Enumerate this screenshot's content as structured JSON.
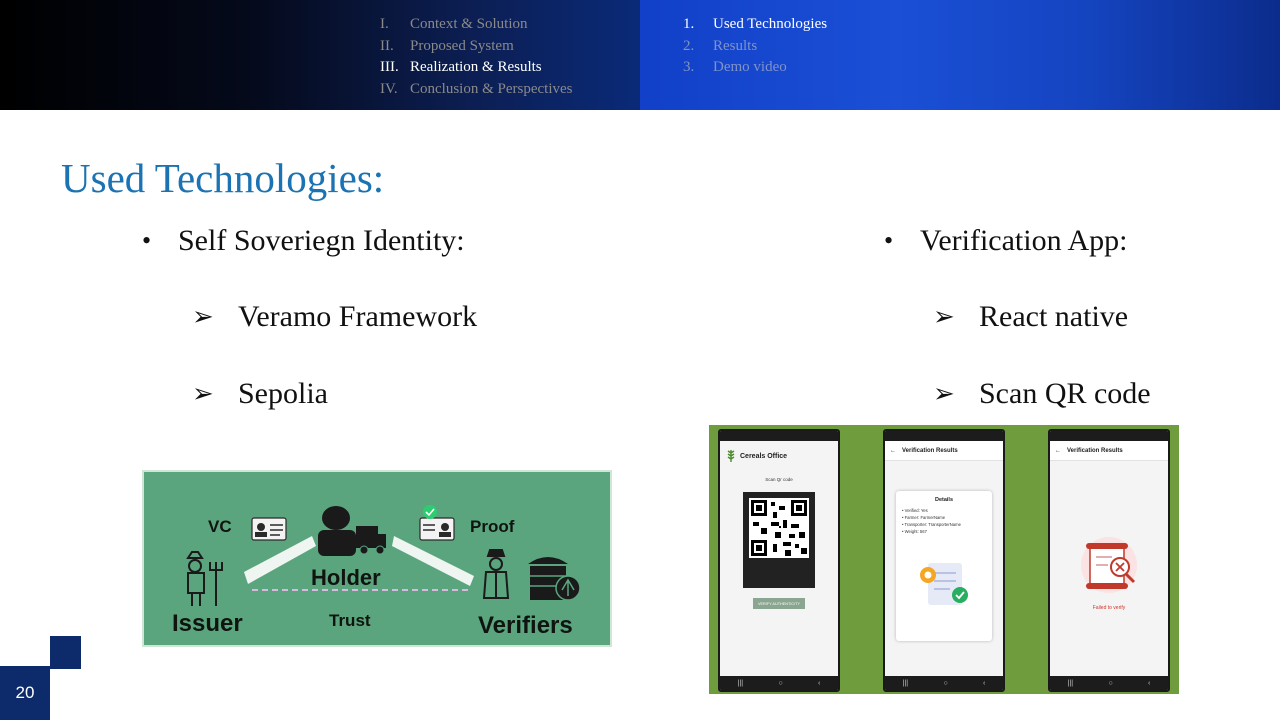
{
  "outline": [
    {
      "num": "I.",
      "label": "Context & Solution",
      "active": false
    },
    {
      "num": "II.",
      "label": "Proposed System",
      "active": false
    },
    {
      "num": "III.",
      "label": "Realization  & Results",
      "active": true
    },
    {
      "num": "IV.",
      "label": "Conclusion & Perspectives",
      "active": false
    }
  ],
  "subnav": [
    {
      "num": "1.",
      "label": "Used Technologies",
      "active": true
    },
    {
      "num": "2.",
      "label": "Results",
      "active": false
    },
    {
      "num": "3.",
      "label": "Demo video",
      "active": false
    }
  ],
  "title": "Used Technologies:",
  "left": {
    "bullet": "Self Soveriegn Identity:",
    "items": [
      "Veramo Framework",
      "Sepolia"
    ]
  },
  "right": {
    "bullet": "Verification App:",
    "items": [
      "React native",
      "Scan QR code"
    ]
  },
  "ssi_diagram": {
    "vc": "VC",
    "proof": "Proof",
    "holder": "Holder",
    "issuer": "Issuer",
    "trust": "Trust",
    "verifiers": "Verifiers"
  },
  "phones": {
    "phone1": {
      "app_title": "Cereals Office",
      "scan_label": "Scan Qr code",
      "button": "VERIFY AUTHENTICITY"
    },
    "phone2": {
      "title": "Verification Results",
      "details_heading": "Details",
      "details": [
        "• Verified: Yes",
        "• Farmer: FarmerName",
        "• Transporter: TransporterName",
        "• Weight: 567"
      ]
    },
    "phone3": {
      "title": "Verification Results",
      "failed": "Failed to verify"
    }
  },
  "slide_number": "20",
  "colors": {
    "title": "#1b73b3",
    "diagram_bg": "#5aa57e",
    "phones_bg": "#6f9c3c",
    "corner": "#0d2a6b"
  }
}
